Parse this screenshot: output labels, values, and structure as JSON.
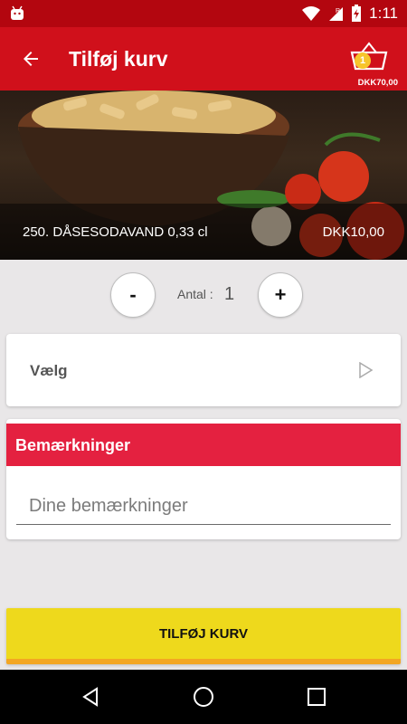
{
  "status_bar": {
    "time": "1:11",
    "icons": [
      "android-icon",
      "wifi-icon",
      "signal-icon",
      "battery-charging-icon"
    ]
  },
  "app_bar": {
    "title": "Tilføj kurv",
    "cart_count": "1",
    "cart_total": "DKK70,00"
  },
  "product": {
    "name": "250.  DÅSESODAVAND  0,33 cl",
    "price": "DKK10,00"
  },
  "quantity": {
    "minus_label": "-",
    "plus_label": "+",
    "label": "Antal :",
    "value": "1"
  },
  "choose": {
    "label": "Vælg"
  },
  "remarks": {
    "title": "Bemærkninger",
    "placeholder": "Dine bemærkninger",
    "value": ""
  },
  "add_button": {
    "label": "TILFØJ KURV"
  },
  "colors": {
    "status_bar": "#b3060f",
    "app_bar": "#d0101b",
    "remarks_header": "#e42140",
    "add_button": "#eed91c",
    "add_button_accent": "#f3a623"
  }
}
